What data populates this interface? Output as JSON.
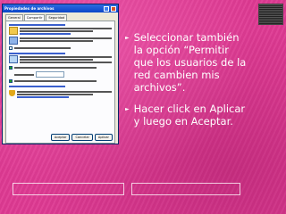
{
  "dialog": {
    "title": "Propiedades de archivos",
    "tabs": [
      "General",
      "Compartir",
      "Seguridad"
    ],
    "buttons": [
      "Aceptar",
      "Cancelar",
      "Aplicar"
    ]
  },
  "bullets": [
    {
      "icon": "arrow-bullet-icon",
      "text": "Seleccionar también\nla opción “Permitir\nque los usuarios de la\nred cambien mis\narchivos”."
    },
    {
      "icon": "arrow-bullet-icon",
      "text": "Hacer click en Aplicar\ny luego en Aceptar."
    }
  ],
  "colors": {
    "background": "#df3a93",
    "text": "#ffffff"
  }
}
